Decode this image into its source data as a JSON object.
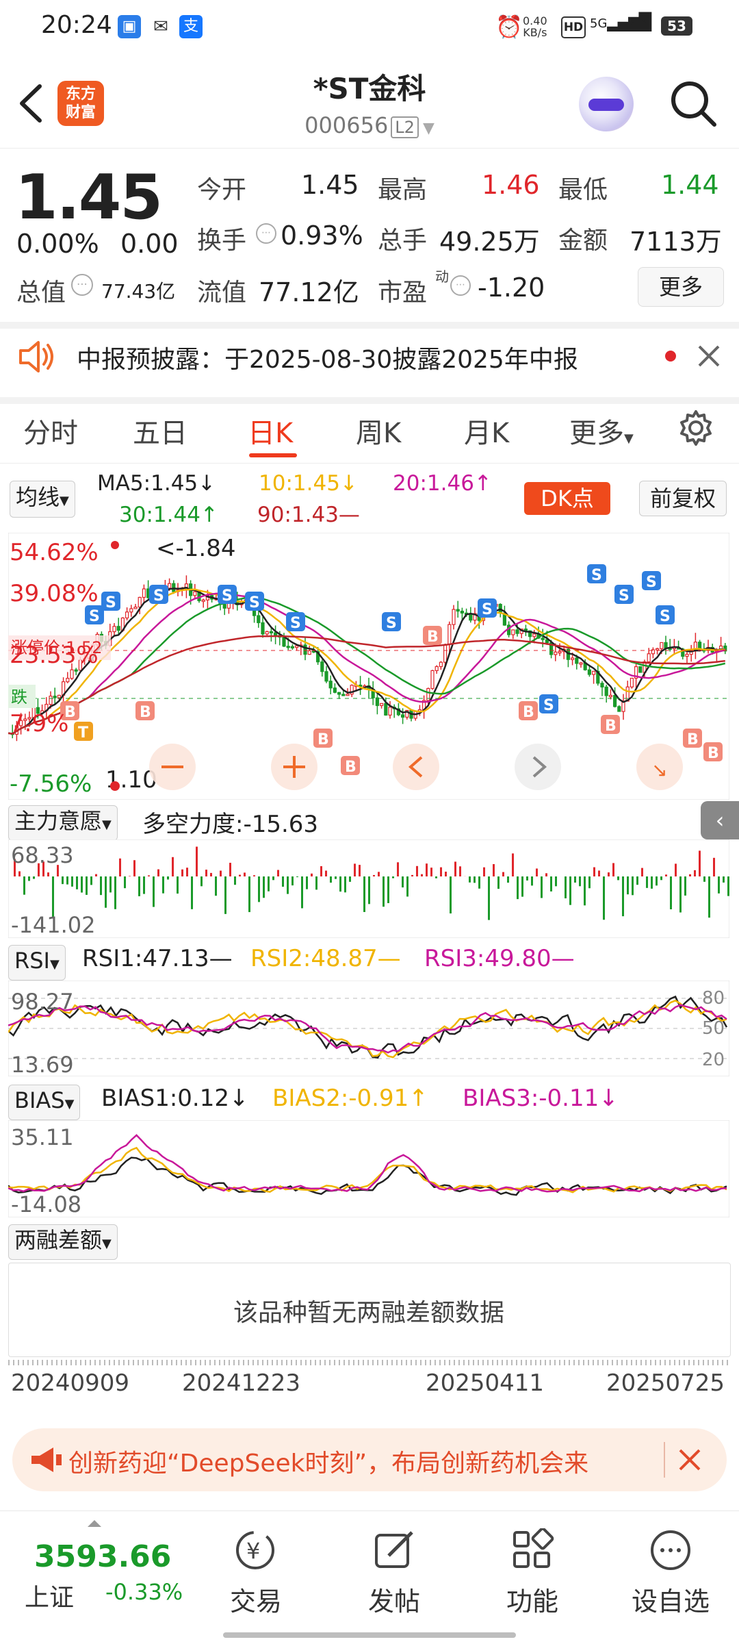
{
  "status": {
    "time": "20:24",
    "speed_top": "0.40",
    "speed_unit": "KB/s",
    "hd": "HD",
    "network": "5G",
    "battery": "53"
  },
  "header": {
    "logo_line1": "东方",
    "logo_line2": "财富",
    "stock_name": "*ST金科",
    "stock_code": "000656",
    "level": "L2"
  },
  "quote": {
    "price": "1.45",
    "change_pct": "0.00%",
    "change": "0.00",
    "open_label": "今开",
    "open": "1.45",
    "high_label": "最高",
    "high": "1.46",
    "low_label": "最低",
    "low": "1.44",
    "turnover_label": "换手",
    "turnover": "0.93%",
    "volume_label": "总手",
    "volume": "49.25万",
    "amount_label": "金额",
    "amount": "7113万",
    "mktcap_label": "总值",
    "mktcap": "77.43亿",
    "float_label": "流值",
    "float_cap": "77.12亿",
    "pe_label": "市盈",
    "pe_sup": "动",
    "pe": "-1.20",
    "more_label": "更多"
  },
  "notice": {
    "text": "中报预披露：于2025-08-30披露2025年中报"
  },
  "tabs": [
    {
      "label": "分时"
    },
    {
      "label": "五日"
    },
    {
      "label": "日K"
    },
    {
      "label": "周K"
    },
    {
      "label": "月K"
    },
    {
      "label": "更多"
    }
  ],
  "ma_row": {
    "selector": "均线",
    "ma5": "MA5:1.45↓",
    "ma10": "10:1.45↓",
    "ma20": "20:1.46↑",
    "ma30": "30:1.44↑",
    "ma90": "90:1.43—",
    "dk_label": "DK点",
    "adjust_label": "前复权"
  },
  "kchart": {
    "pct_labels": [
      "54.62%",
      "39.08%",
      "23.53%",
      "7.9%",
      "-7.56%"
    ],
    "high_note": "<-1.84",
    "low_note": "1.10",
    "limit_up_label": "涨停价:1.52",
    "limit_down_label": "跌"
  },
  "ind_main": {
    "selector": "主力意愿",
    "value": "多空力度:-15.63",
    "ymax": "68.33",
    "ymin": "-141.02"
  },
  "rsi": {
    "selector": "RSI",
    "rsi1": "RSI1:47.13—",
    "rsi2": "RSI2:48.87—",
    "rsi3": "RSI3:49.80—",
    "ymax": "98.27",
    "ymin": "13.69",
    "levels": [
      "80",
      "50",
      "20"
    ]
  },
  "bias": {
    "selector": "BIAS",
    "bias1": "BIAS1:0.12↓",
    "bias2": "BIAS2:-0.91↑",
    "bias3": "BIAS3:-0.11↓",
    "ymax": "35.11",
    "ymin": "-14.08"
  },
  "margin": {
    "selector": "两融差额",
    "empty_text": "该品种暂无两融差额数据"
  },
  "dates": [
    "20240909",
    "20241223",
    "20250411",
    "20250725"
  ],
  "banner": {
    "text": "创新药迎“DeepSeek时刻”，布局创新药机会来"
  },
  "bottom": {
    "index_value": "3593.66",
    "index_name": "上证",
    "index_change": "-0.33%",
    "nav": [
      {
        "label": "交易"
      },
      {
        "label": "发帖"
      },
      {
        "label": "功能"
      },
      {
        "label": "设自选"
      }
    ]
  },
  "colors": {
    "up": "#e0262b",
    "down": "#1a9a2a",
    "accent": "#ef3a1d",
    "ma10": "#f0b400",
    "ma20": "#c8189a",
    "ma30": "#1a9a2a",
    "ma90": "#c0262b"
  }
}
